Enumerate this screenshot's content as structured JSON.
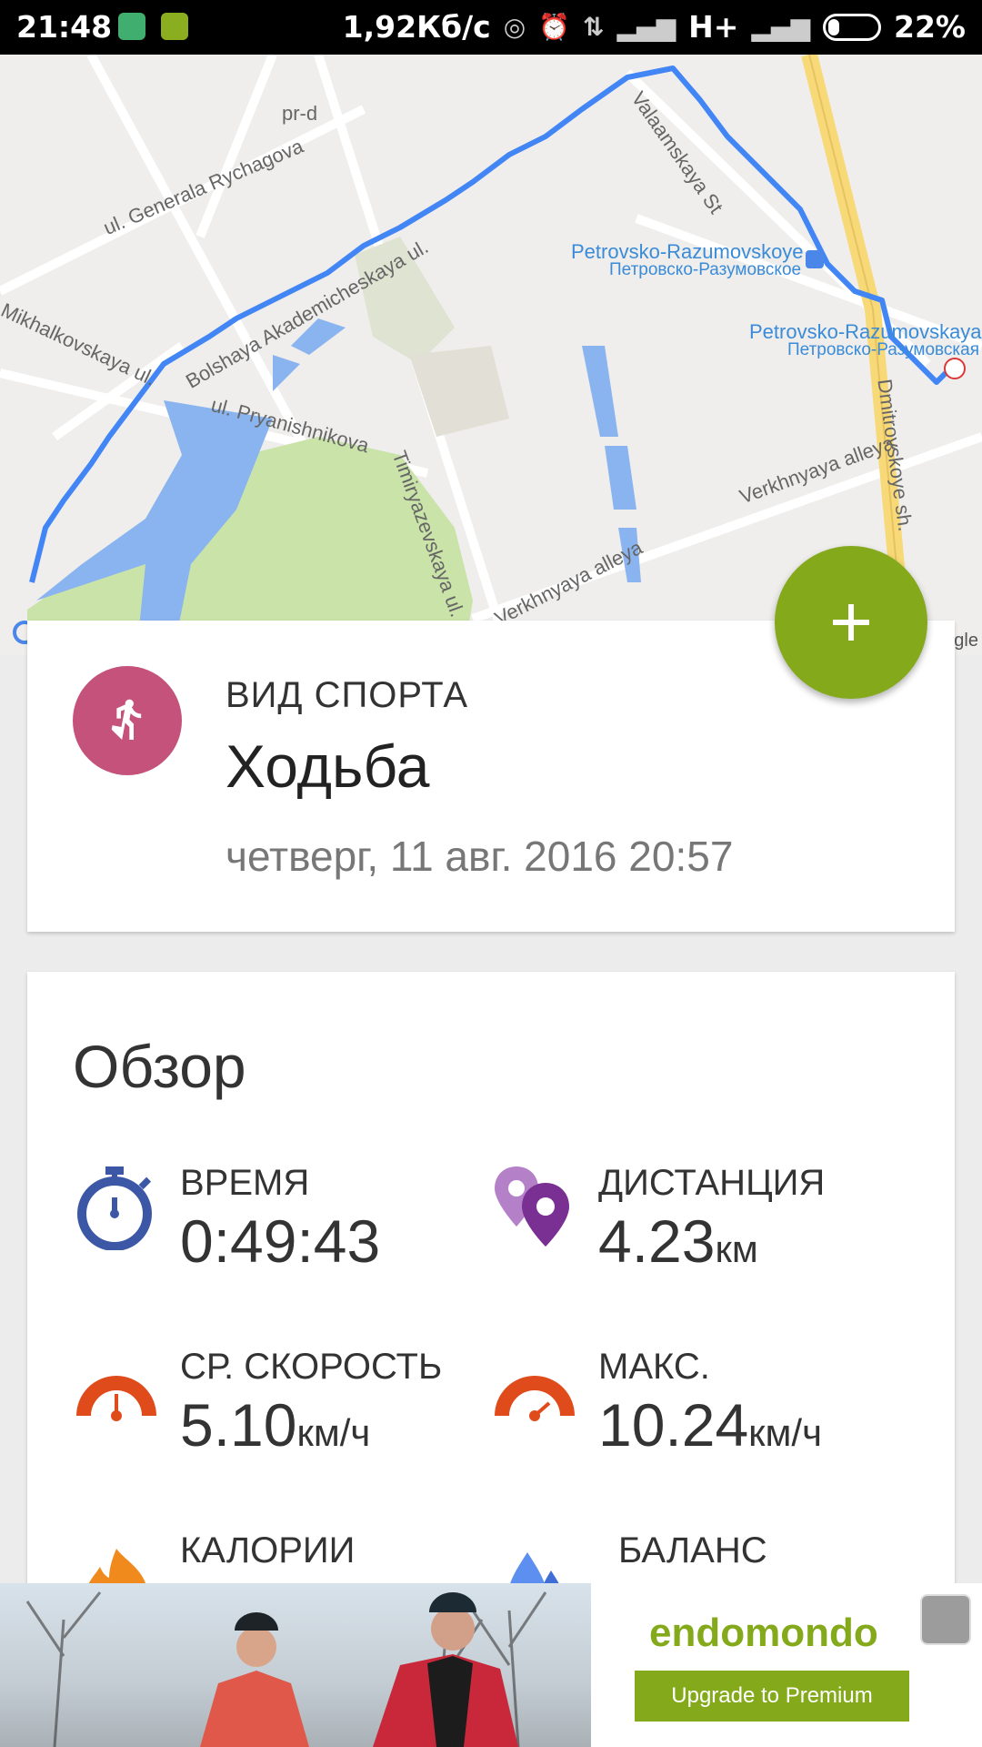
{
  "status_bar": {
    "time": "21:48",
    "network_speed": "1,92Кб/с",
    "network_type": "H+",
    "battery": "22%"
  },
  "map": {
    "labels": {
      "street1": "ul. Generala Rychagova",
      "street2": "Mikhalkovskaya ul.",
      "street3": "Bolshaya Akademicheskaya ul.",
      "street4": "ul. Pryanishnikova",
      "street5": "Timiryazevskaya ul.",
      "street6": "Verkhnyaya alleya",
      "street7": "Verkhnyaya alleya",
      "street8": "Valaamskaya St",
      "street9": "Dmitrovskoye sh.",
      "street10": "pr-d",
      "station1_en": "Petrovsko-Razumovskoye",
      "station1_ru": "Петровско-Разумовское",
      "station2_en": "Petrovsko-Razumovskaya",
      "station2_ru": "Петровско-Разумовская"
    },
    "attribution": "gle",
    "route_color": "#4285f4"
  },
  "sport_card": {
    "label": "ВИД СПОРТА",
    "value": "Ходьба",
    "date": "четверг, 11 авг. 2016 20:57",
    "icon": "walking-person-icon",
    "avatar_color": "#c4527a"
  },
  "fab": {
    "icon": "plus-icon",
    "color": "#84aa1c"
  },
  "overview": {
    "title": "Обзор",
    "stats": [
      {
        "label": "ВРЕМЯ",
        "value": "0:49:43",
        "unit": "",
        "icon": "stopwatch-icon"
      },
      {
        "label": "ДИСТАНЦИЯ",
        "value": "4.23",
        "unit": "км",
        "icon": "location-pins-icon"
      },
      {
        "label": "СР. СКОРОСТЬ",
        "value": "5.10",
        "unit": "км/ч",
        "icon": "speedometer-icon"
      },
      {
        "label": "МАКС.",
        "value": "10.24",
        "unit": "км/ч",
        "icon": "speedometer-icon"
      },
      {
        "label": "КАЛОРИИ",
        "value": "",
        "unit": "",
        "icon": "flame-icon"
      },
      {
        "label": "БАЛАНС",
        "value": "",
        "unit": "",
        "icon": "water-drops-icon"
      }
    ]
  },
  "ad": {
    "brand": "endomondo",
    "button_label": "Upgrade to Premium"
  }
}
